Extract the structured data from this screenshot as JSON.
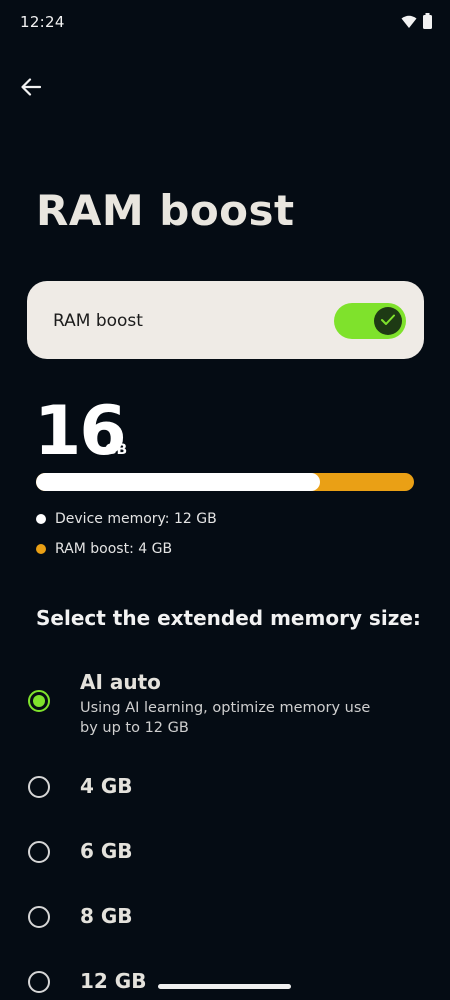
{
  "status_bar": {
    "time": "12:24"
  },
  "header": {
    "title": "RAM boost"
  },
  "toggle": {
    "label": "RAM boost",
    "enabled": true,
    "accent": "#7fe22c"
  },
  "memory": {
    "total_value": "16",
    "total_unit": "GB",
    "device_fraction": 0.75,
    "device_color": "#ffffff",
    "boost_color": "#eaa015",
    "legend": [
      {
        "label": "Device memory: 12 GB"
      },
      {
        "label": "RAM boost: 4 GB"
      }
    ]
  },
  "options_section": {
    "title": "Select the extended memory size:",
    "options": [
      {
        "label": "AI auto",
        "description": "Using AI learning, optimize memory use by up to 12 GB",
        "selected": true
      },
      {
        "label": "4 GB",
        "selected": false
      },
      {
        "label": "6 GB",
        "selected": false
      },
      {
        "label": "8 GB",
        "selected": false
      },
      {
        "label": "12 GB",
        "selected": false
      }
    ]
  }
}
